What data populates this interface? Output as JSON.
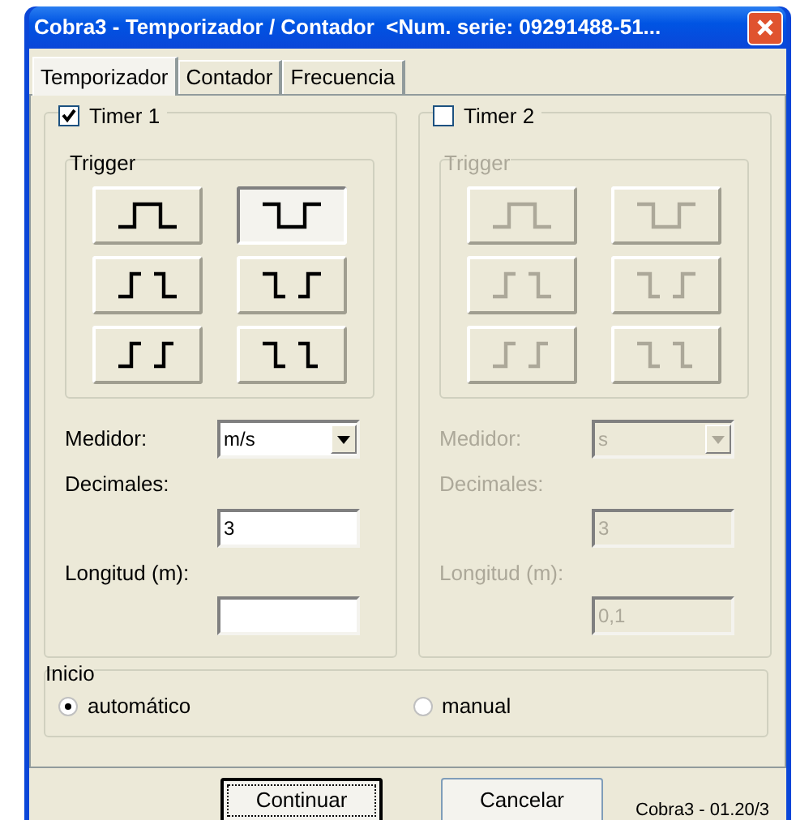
{
  "window": {
    "title": "Cobra3 - Temporizador / Contador  <Num. serie: 09291488-51..."
  },
  "tabs": [
    {
      "label": "Temporizador",
      "selected": true
    },
    {
      "label": "Contador",
      "selected": false
    },
    {
      "label": "Frecuencia",
      "selected": false
    }
  ],
  "timers": [
    {
      "label": "Timer 1",
      "checked": true,
      "disabled": false,
      "trigger": {
        "label": "Trigger",
        "buttons": [
          {
            "kind": "pulse_high",
            "selected": false
          },
          {
            "kind": "pulse_low",
            "selected": true
          },
          {
            "kind": "rise_fall",
            "selected": false
          },
          {
            "kind": "fall_rise",
            "selected": false
          },
          {
            "kind": "rise_rise",
            "selected": false
          },
          {
            "kind": "fall_fall",
            "selected": false
          }
        ]
      },
      "medidor": {
        "label": "Medidor:",
        "value": "m/s"
      },
      "decimales": {
        "label": "Decimales:",
        "value": "3"
      },
      "longitud": {
        "label": "Longitud (m):"
      }
    },
    {
      "label": "Timer 2",
      "checked": false,
      "disabled": true,
      "trigger": {
        "label": "Trigger",
        "buttons": [
          {
            "kind": "pulse_high",
            "selected": false
          },
          {
            "kind": "pulse_low",
            "selected": false
          },
          {
            "kind": "rise_fall",
            "selected": false
          },
          {
            "kind": "fall_rise",
            "selected": false
          },
          {
            "kind": "rise_rise",
            "selected": false
          },
          {
            "kind": "fall_fall",
            "selected": false
          }
        ]
      },
      "medidor": {
        "label": "Medidor:",
        "value": "s"
      },
      "decimales": {
        "label": "Decimales:",
        "value": "3"
      },
      "longitud": {
        "label": "Longitud (m):",
        "value": "0,1"
      }
    }
  ],
  "inicio": {
    "label": "Inicio",
    "options": [
      {
        "label": "automático",
        "selected": true
      },
      {
        "label": "manual",
        "selected": false
      }
    ]
  },
  "buttons": [
    {
      "label": "Continuar",
      "default": true
    },
    {
      "label": "Cancelar",
      "default": false
    }
  ],
  "version": "Cobra3 - 01.20/3"
}
